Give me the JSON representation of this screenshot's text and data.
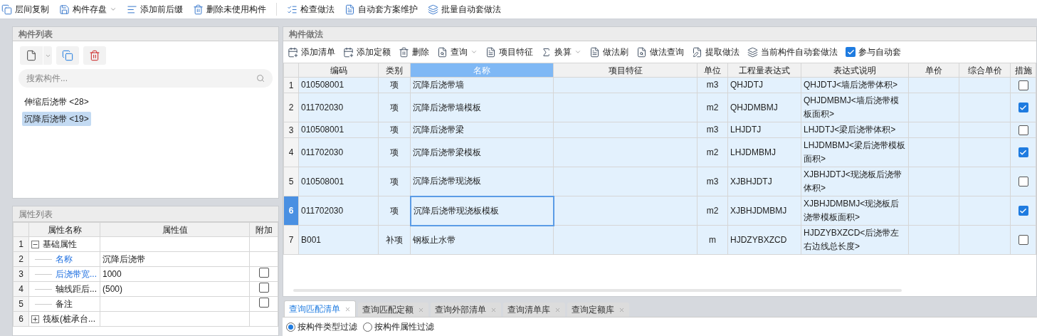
{
  "toolbar": [
    {
      "label": "层间复制",
      "menu": false
    },
    {
      "label": "构件存盘",
      "menu": true
    },
    {
      "label": "添加前后缀",
      "menu": false
    },
    {
      "label": "删除未使用构件",
      "menu": false
    },
    {
      "label": "检查做法",
      "menu": false
    },
    {
      "label": "自动套方案维护",
      "menu": false
    },
    {
      "label": "批量自动套做法",
      "menu": false
    }
  ],
  "component_list": {
    "title": "构件列表",
    "search": {
      "placeholder": "搜索构件..."
    },
    "items": [
      {
        "label": "伸缩后浇带 <28>",
        "selected": false
      },
      {
        "label": "沉降后浇带 <19>",
        "selected": true
      }
    ]
  },
  "property_list": {
    "title": "属性列表",
    "columns": [
      "属性名称",
      "属性值",
      "附加"
    ],
    "rows": [
      {
        "index": "1",
        "name": "基础属性",
        "expanded": true,
        "children": [
          {
            "index": "2",
            "name": "名称",
            "value": "沉降后浇带",
            "public": true
          },
          {
            "index": "3",
            "name": "后浇带宽...",
            "value": "1000",
            "public": true,
            "attach_checked": false
          },
          {
            "index": "4",
            "name": "轴线距后...",
            "value": "(500)",
            "public": false,
            "attach_checked": false
          },
          {
            "index": "5",
            "name": "备注",
            "public": false,
            "attach_checked": false
          }
        ]
      },
      {
        "index": "6",
        "name": "筏板(桩承台...",
        "expanded": false,
        "children": []
      }
    ]
  },
  "method_panel": {
    "title": "构件做法",
    "toolbar": [
      {
        "kind": "button",
        "label": "添加清单",
        "menu": false
      },
      {
        "kind": "button",
        "label": "添加定额",
        "menu": false
      },
      {
        "kind": "button",
        "label": "删除",
        "menu": false
      },
      {
        "kind": "button",
        "label": "查询",
        "menu": true
      },
      {
        "kind": "button",
        "label": "项目特征",
        "menu": false
      },
      {
        "kind": "button",
        "label": "换算",
        "menu": true
      },
      {
        "kind": "button",
        "label": "做法刷",
        "menu": false
      },
      {
        "kind": "button",
        "label": "做法查询",
        "menu": false
      },
      {
        "kind": "button",
        "label": "提取做法",
        "menu": false
      },
      {
        "kind": "button",
        "label": "当前构件自动套做法",
        "menu": false
      },
      {
        "kind": "checkbox",
        "label": "参与自动套",
        "checked": true
      }
    ],
    "columns": [
      {
        "label": "编码",
        "selected": false
      },
      {
        "label": "类别",
        "selected": false
      },
      {
        "label": "名称",
        "selected": true
      },
      {
        "label": "项目特征",
        "selected": false
      },
      {
        "label": "单位",
        "selected": false
      },
      {
        "label": "工程量表达式",
        "selected": false
      },
      {
        "label": "表达式说明",
        "selected": false
      },
      {
        "label": "单价",
        "selected": false
      },
      {
        "label": "综合单价",
        "selected": false
      },
      {
        "label": "措施",
        "selected": false
      }
    ],
    "rows": [
      {
        "index": "1",
        "code": "010508001",
        "type": "项",
        "name": "沉降后浇带墙",
        "unit": "m3",
        "expr": "QHJDTJ",
        "desc": "QHJDTJ<墙后浇带体积>",
        "measure": false,
        "selected": false
      },
      {
        "index": "2",
        "code": "011702030",
        "type": "项",
        "name": "沉降后浇带墙模板",
        "unit": "m2",
        "expr": "QHJDMBMJ",
        "desc": "QHJDMBMJ<墙后浇带模板面积>",
        "measure": true,
        "selected": false
      },
      {
        "index": "3",
        "code": "010508001",
        "type": "项",
        "name": "沉降后浇带梁",
        "unit": "m3",
        "expr": "LHJDTJ",
        "desc": "LHJDTJ<梁后浇带体积>",
        "measure": false,
        "selected": false
      },
      {
        "index": "4",
        "code": "011702030",
        "type": "项",
        "name": "沉降后浇带梁模板",
        "unit": "m2",
        "expr": "LHJDMBMJ",
        "desc": "LHJDMBMJ<梁后浇带模板面积>",
        "measure": true,
        "selected": false
      },
      {
        "index": "5",
        "code": "010508001",
        "type": "项",
        "name": "沉降后浇带现浇板",
        "unit": "m3",
        "expr": "XJBHJDTJ",
        "desc": "XJBHJDTJ<现浇板后浇带体积>",
        "measure": false,
        "selected": false
      },
      {
        "index": "6",
        "code": "011702030",
        "type": "项",
        "name": "沉降后浇带现浇板模板",
        "unit": "m2",
        "expr": "XJBHJDMBMJ",
        "desc": "XJBHJDMBMJ<现浇板后浇带模板面积>",
        "measure": true,
        "selected": true
      },
      {
        "index": "7",
        "code": "B001",
        "type": "补项",
        "name": "钢板止水带",
        "unit": "m",
        "expr": "HJDZYBXZCD",
        "desc": "HJDZYBXZCD<后浇带左右边线总长度>",
        "measure": false,
        "selected": false
      }
    ]
  },
  "bottom_tabs": [
    {
      "label": "查询匹配清单",
      "selected": true
    },
    {
      "label": "查询匹配定额",
      "selected": false
    },
    {
      "label": "查询外部清单",
      "selected": false
    },
    {
      "label": "查询清单库",
      "selected": false
    },
    {
      "label": "查询定额库",
      "selected": false
    }
  ],
  "filters": [
    {
      "label": "按构件类型过滤",
      "selected": true
    },
    {
      "label": "按构件属性过滤",
      "selected": false
    }
  ]
}
